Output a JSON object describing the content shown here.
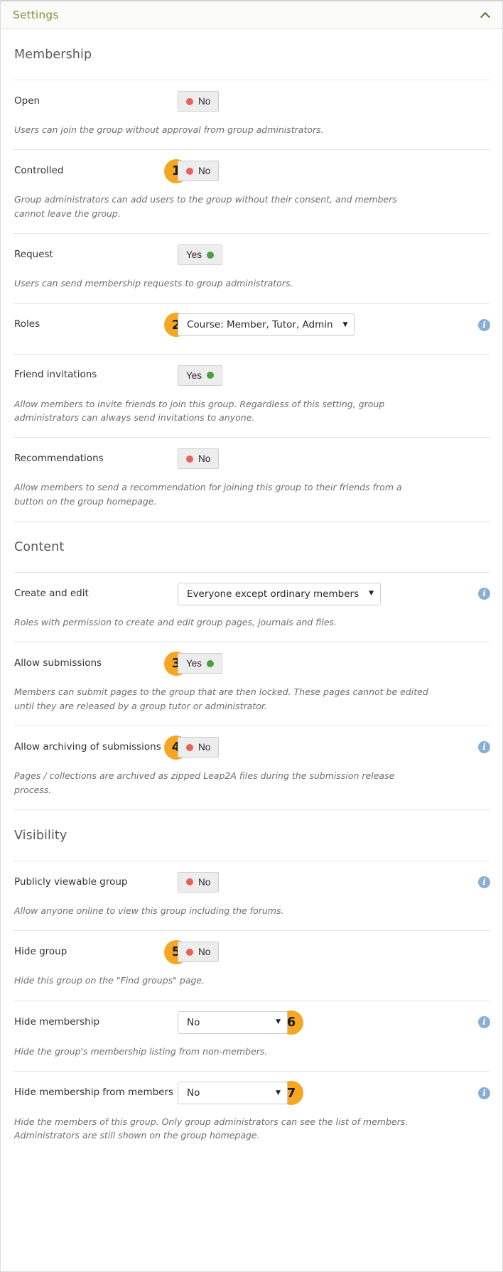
{
  "header": {
    "title": "Settings",
    "collapse_icon": "chevron-up-icon"
  },
  "colors": {
    "header_text": "#8a8f3e",
    "badge": "#f5a623",
    "dot_no": "#e8615b",
    "dot_yes": "#4aa13f",
    "info_icon": "#8aaed4"
  },
  "sections": [
    {
      "title": "Membership",
      "rows": [
        {
          "label": "Open",
          "control": {
            "kind": "toggle",
            "value": "No",
            "state": "no"
          },
          "badge": null,
          "info": false,
          "help": "Users can join the group without approval from group administrators."
        },
        {
          "label": "Controlled",
          "control": {
            "kind": "toggle",
            "value": "No",
            "state": "no"
          },
          "badge": "1",
          "info": false,
          "help": "Group administrators can add users to the group without their consent, and members cannot leave the group."
        },
        {
          "label": "Request",
          "control": {
            "kind": "toggle",
            "value": "Yes",
            "state": "yes"
          },
          "badge": null,
          "info": false,
          "help": "Users can send membership requests to group administrators."
        },
        {
          "label": "Roles",
          "control": {
            "kind": "select",
            "value": "Course: Member, Tutor, Admin",
            "caret": "▼"
          },
          "badge": "2",
          "info": true,
          "help": null
        },
        {
          "label": "Friend invitations",
          "control": {
            "kind": "toggle",
            "value": "Yes",
            "state": "yes"
          },
          "badge": null,
          "info": false,
          "help": "Allow members to invite friends to join this group. Regardless of this setting, group administrators can always send invitations to anyone."
        },
        {
          "label": "Recommendations",
          "control": {
            "kind": "toggle",
            "value": "No",
            "state": "no"
          },
          "badge": null,
          "info": false,
          "help": "Allow members to send a recommendation for joining this group to their friends from a button on the group homepage."
        }
      ]
    },
    {
      "title": "Content",
      "rows": [
        {
          "label": "Create and edit",
          "control": {
            "kind": "select",
            "value": "Everyone except ordinary members",
            "caret": "▼"
          },
          "badge": null,
          "info": true,
          "help": "Roles with permission to create and edit group pages, journals and files."
        },
        {
          "label": "Allow submissions",
          "control": {
            "kind": "toggle",
            "value": "Yes",
            "state": "yes"
          },
          "badge": "3",
          "info": false,
          "help": "Members can submit pages to the group that are then locked. These pages cannot be edited until they are released by a group tutor or administrator."
        },
        {
          "label": "Allow archiving of submissions",
          "control": {
            "kind": "toggle",
            "value": "No",
            "state": "no"
          },
          "badge": "4",
          "info": true,
          "help": "Pages / collections are archived as zipped Leap2A files during the submission release process."
        }
      ]
    },
    {
      "title": "Visibility",
      "rows": [
        {
          "label": "Publicly viewable group",
          "control": {
            "kind": "toggle",
            "value": "No",
            "state": "no"
          },
          "badge": null,
          "info": true,
          "help": "Allow anyone online to view this group including the forums."
        },
        {
          "label": "Hide group",
          "control": {
            "kind": "toggle",
            "value": "No",
            "state": "no"
          },
          "badge": "5",
          "info": false,
          "help": "Hide this group on the \"Find groups\" page."
        },
        {
          "label": "Hide membership",
          "control": {
            "kind": "select-wide",
            "value": "No",
            "caret": "▼"
          },
          "badge": "6",
          "badge_side": "right",
          "info": true,
          "help": "Hide the group's membership listing from non-members."
        },
        {
          "label": "Hide membership from members",
          "control": {
            "kind": "select-wide",
            "value": "No",
            "caret": "▼"
          },
          "badge": "7",
          "badge_side": "right",
          "info": true,
          "help": "Hide the members of this group. Only group administrators can see the list of members. Administrators are still shown on the group homepage."
        }
      ]
    }
  ]
}
